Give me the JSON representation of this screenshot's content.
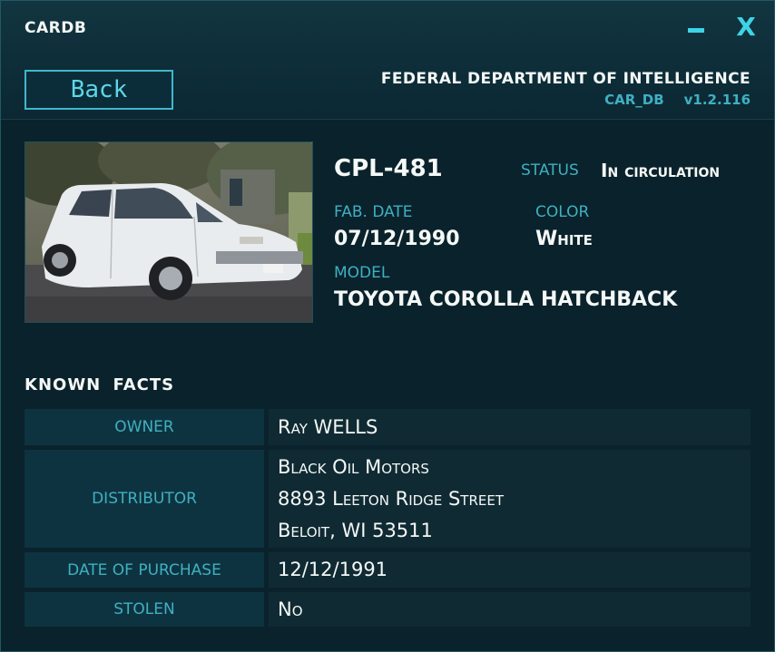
{
  "window": {
    "title": "CARDB",
    "minimize_icon": "minimize-icon",
    "close_label": "X"
  },
  "header": {
    "back_label": "Back",
    "agency": "FEDERAL DEPARTMENT OF INTELLIGENCE",
    "db_name": "CAR_DB",
    "version": "v1.2.116"
  },
  "vehicle": {
    "plate": "CPL-481",
    "status_label": "STATUS",
    "status_value": "In circulation",
    "fab_date_label": "FAB. DATE",
    "fab_date_value": "07/12/1990",
    "color_label": "COLOR",
    "color_value": "White",
    "model_label": "MODEL",
    "model_value": "TOYOTA COROLLA HATCHBACK"
  },
  "facts": {
    "title": "KNOWN FACTS",
    "rows": [
      {
        "label": "OWNER",
        "lines": [
          "Ray WELLS"
        ]
      },
      {
        "label": "DISTRIBUTOR",
        "lines": [
          "Black Oil Motors",
          "8893 Leeton Ridge Street",
          "Beloit, WI 53511"
        ]
      },
      {
        "label": "DATE OF PURCHASE",
        "lines": [
          "12/12/1991"
        ]
      },
      {
        "label": "STOLEN",
        "lines": [
          "No"
        ]
      }
    ]
  },
  "colors": {
    "accent": "#3fd3e6",
    "label": "#3fb0c2",
    "background": "#0a222b",
    "cell_left": "#0e3340",
    "cell_right": "#102a33"
  }
}
